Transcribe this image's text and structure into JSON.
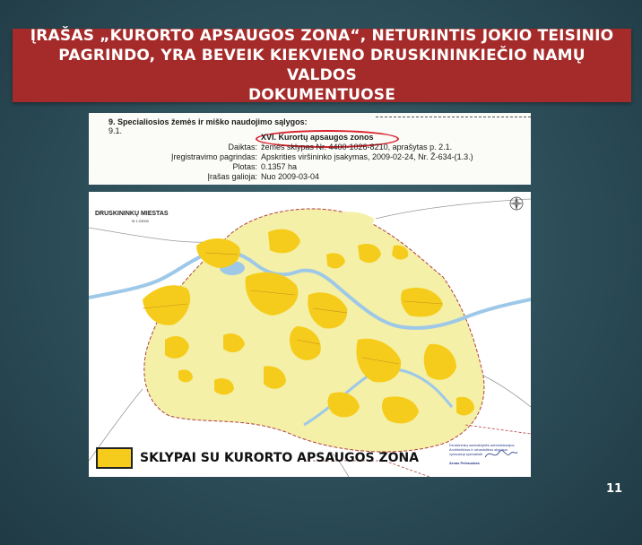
{
  "slide": {
    "title": "ĮRAŠAS „KURORTO APSAUGOS ZONA“, NETURINTIS JOKIO TEISINIO\nPAGRINDO, YRA BEVEIK KIEKVIENO DRUSKININKIEČIO NAMŲ VALDOS\nDOKUMENTUOSE",
    "page_number": "11"
  },
  "document_excerpt": {
    "heading": "9. Specialiosios žemės ir miško naudojimo sąlygos:",
    "item_number": "9.1.",
    "rows": [
      {
        "label": "",
        "value": "XVI. Kurortų apsaugos zonos"
      },
      {
        "label": "Daiktas:",
        "value": "žemės sklypas Nr. 4400-1026-8210, aprašytas p. 2.1."
      },
      {
        "label": "Įregistravimo pagrindas:",
        "value": "Apskrities viršininko įsakymas, 2009-02-24, Nr. Ž-634-(1.3.)"
      },
      {
        "label": "Plotas:",
        "value": "0.1357 ha"
      },
      {
        "label": "Įrašas galioja:",
        "value": "Nuo 2009-03-04"
      }
    ]
  },
  "map": {
    "title": "DRUSKININKŲ MIESTAS",
    "scale": "M 1:23000",
    "legend_label": "SKLYPAI SU KURORTO APSAUGOS ZONA",
    "stamp_lines": [
      "Druskininkų savivaldybės administracijos",
      "Architektūros ir urbanistikos skyriaus",
      "vyriausioji specialistė",
      "",
      "Arnas Petrauskas"
    ]
  },
  "colors": {
    "title_bar": "#a52a2a",
    "zone_fill": "#f6cc1c",
    "territory_fill": "#f4f0a8",
    "water": "#9ec8e8",
    "boundary": "#b04040"
  }
}
